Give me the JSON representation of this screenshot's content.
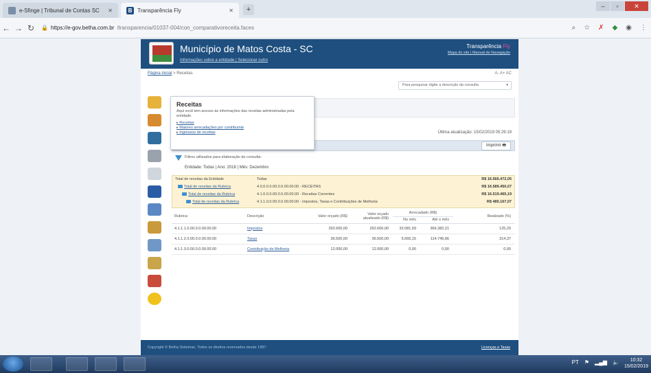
{
  "browser": {
    "tabs": [
      {
        "label": "e-Sfinge | Tribunal de Contas SC",
        "active": false
      },
      {
        "label": "Transparência Fly",
        "active": true
      }
    ],
    "url_host": "https://e-gov.betha.com.br",
    "url_path": "/transparencia/01037-004/con_comparativoreceita.faces"
  },
  "header": {
    "title": "Município de Matos Costa - SC",
    "subtitle": "Informações sobre a entidade | Selecionar outro",
    "brand": "Transparência",
    "brand_accent": "Fly",
    "links": "Mapa do site | Manual de Navegação"
  },
  "breadcrumb": {
    "home": "Página inicial",
    "sep": ">",
    "current": "Receitas"
  },
  "font_controls": "A-  A+  AC",
  "search": {
    "placeholder": "Para pesquisar digite a descrição da consulta"
  },
  "popup": {
    "title": "Receitas",
    "description": "Aqui você tem acesso às informações das receitas administradas pela entidade.",
    "links": [
      "Receitas",
      "Maiores arrecadações por contribuinte",
      "Ingressos de receitas"
    ]
  },
  "last_update": "Última atualização: 15/02/2019 05:29:19",
  "print_label": "Imprimir",
  "filter": {
    "caption": "Filtros utilizados para elaboração da consulta:",
    "values": "Entidade: Todas | Ano: 2018 | Mês: Dezembro"
  },
  "totals": [
    {
      "label": "Total de receitas da Entidade",
      "code": "Todas",
      "value": "R$ 16.566.472,05"
    },
    {
      "label": "Total de receitas da Rubrica",
      "code": "4.0.0.0.0.00.0.0.00.00.00 - RECEITAS",
      "value": "R$ 16.589.450,07"
    },
    {
      "label": "Total de receitas da Rubrica",
      "code": "4.1.0.0.0.00.0.0.00.00.00 - Receitas Correntes",
      "value": "R$ 16.519.465,19"
    },
    {
      "label": "Total de receitas da Rubrica",
      "code": "4.1.1.0.0.00.0.0.00.00.00 - Impostos, Taxas e Contribuições de Melhoria",
      "value": "R$ 485.167,07"
    }
  ],
  "table": {
    "headers": [
      "Rubrica",
      "Descrição",
      "Valor orçado (R$)",
      "Valor orçado atualizado (R$)",
      "Arrecadado (R$)",
      "Realizado (%)"
    ],
    "subheaders": [
      "No mês",
      "Até o mês"
    ],
    "rows": [
      {
        "rubrica": "4.1.1.1.0.00.0.0.00.00.00",
        "descricao": "Impostos",
        "orcado": "292.600,00",
        "atualizado": "292.600,00",
        "mes": "32.081,59",
        "ate": "366.382,21",
        "realizado": "125,29"
      },
      {
        "rubrica": "4.1.1.2.0.00.0.0.00.00.00",
        "descricao": "Taxas",
        "orcado": "36.500,00",
        "atualizado": "36.500,00",
        "mes": "5.665,15",
        "ate": "114.745,66",
        "realizado": "314,37"
      },
      {
        "rubrica": "4.1.1.3.0.00.0.0.00.00.00",
        "descricao": "Contribuição de Melhoria",
        "orcado": "12.000,00",
        "atualizado": "12.000,00",
        "mes": "0,00",
        "ate": "0,00",
        "realizado": "0,00"
      }
    ]
  },
  "footer": {
    "left": "Copyright © Betha Sistemas. Todos os direitos reservados desde 1987.",
    "right": "Licenças e Taxas"
  },
  "taskbar": {
    "lang": "PT",
    "time": "10:32",
    "date": "15/02/2019"
  },
  "colors": {
    "header_blue": "#1e4f7f",
    "totals_bg": "#fdf3d4",
    "link": "#2a5c98",
    "brand_accent": "#e94fa0"
  }
}
